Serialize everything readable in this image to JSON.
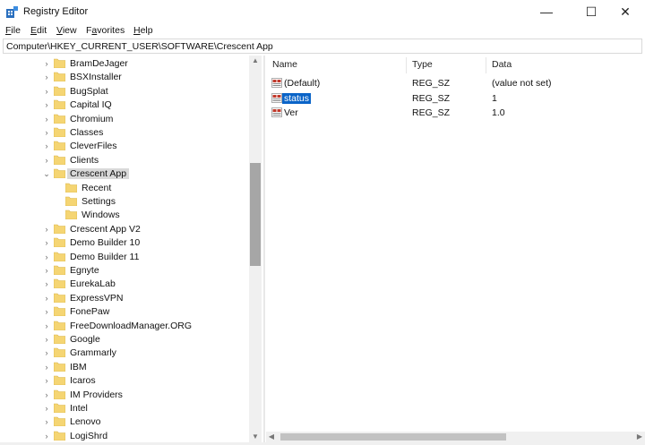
{
  "window": {
    "title": "Registry Editor",
    "minimize_glyph": "—",
    "maximize_glyph": "☐",
    "close_glyph": "✕"
  },
  "menu": [
    {
      "underline": "F",
      "rest": "ile"
    },
    {
      "underline": "E",
      "rest": "dit"
    },
    {
      "underline": "V",
      "rest": "iew"
    },
    {
      "pre": "F",
      "underline": "a",
      "rest": "vorites"
    },
    {
      "underline": "H",
      "rest": "elp"
    }
  ],
  "address": "Computer\\HKEY_CURRENT_USER\\SOFTWARE\\Crescent App",
  "tree": {
    "items": [
      {
        "label": "BramDeJager",
        "level": 0,
        "expander": "collapsed"
      },
      {
        "label": "BSXInstaller",
        "level": 0,
        "expander": "collapsed"
      },
      {
        "label": "BugSplat",
        "level": 0,
        "expander": "collapsed"
      },
      {
        "label": "Capital IQ",
        "level": 0,
        "expander": "collapsed"
      },
      {
        "label": "Chromium",
        "level": 0,
        "expander": "collapsed"
      },
      {
        "label": "Classes",
        "level": 0,
        "expander": "collapsed"
      },
      {
        "label": "CleverFiles",
        "level": 0,
        "expander": "collapsed"
      },
      {
        "label": "Clients",
        "level": 0,
        "expander": "collapsed"
      },
      {
        "label": "Crescent App",
        "level": 0,
        "expander": "expanded",
        "selected": true
      },
      {
        "label": "Recent",
        "level": 1,
        "expander": "none"
      },
      {
        "label": "Settings",
        "level": 1,
        "expander": "none"
      },
      {
        "label": "Windows",
        "level": 1,
        "expander": "none"
      },
      {
        "label": "Crescent App V2",
        "level": 0,
        "expander": "collapsed"
      },
      {
        "label": "Demo Builder 10",
        "level": 0,
        "expander": "collapsed"
      },
      {
        "label": "Demo Builder 11",
        "level": 0,
        "expander": "collapsed"
      },
      {
        "label": "Egnyte",
        "level": 0,
        "expander": "collapsed"
      },
      {
        "label": "EurekaLab",
        "level": 0,
        "expander": "collapsed"
      },
      {
        "label": "ExpressVPN",
        "level": 0,
        "expander": "collapsed"
      },
      {
        "label": "FonePaw",
        "level": 0,
        "expander": "collapsed"
      },
      {
        "label": "FreeDownloadManager.ORG",
        "level": 0,
        "expander": "collapsed"
      },
      {
        "label": "Google",
        "level": 0,
        "expander": "collapsed"
      },
      {
        "label": "Grammarly",
        "level": 0,
        "expander": "collapsed"
      },
      {
        "label": "IBM",
        "level": 0,
        "expander": "collapsed"
      },
      {
        "label": "Icaros",
        "level": 0,
        "expander": "collapsed"
      },
      {
        "label": "IM Providers",
        "level": 0,
        "expander": "collapsed"
      },
      {
        "label": "Intel",
        "level": 0,
        "expander": "collapsed"
      },
      {
        "label": "Lenovo",
        "level": 0,
        "expander": "collapsed"
      },
      {
        "label": "LogiShrd",
        "level": 0,
        "expander": "collapsed"
      }
    ]
  },
  "list": {
    "columns": {
      "name": "Name",
      "type": "Type",
      "data": "Data"
    },
    "rows": [
      {
        "name": "(Default)",
        "type": "REG_SZ",
        "data": "(value not set)",
        "selected": false
      },
      {
        "name": "status",
        "type": "REG_SZ",
        "data": "1",
        "selected": true
      },
      {
        "name": "Ver",
        "type": "REG_SZ",
        "data": "1.0",
        "selected": false
      }
    ]
  },
  "icons": {
    "app": "registry-editor-icon",
    "folder": "folder-icon",
    "value": "string-value-icon",
    "collapsed": "chevron-right-icon",
    "expanded": "chevron-down-icon"
  },
  "colors": {
    "folder": "#f5d573",
    "selection_blue": "#0a64c8",
    "tree_selection": "#d9d9d9",
    "reg_icon_red": "#c0392b"
  }
}
